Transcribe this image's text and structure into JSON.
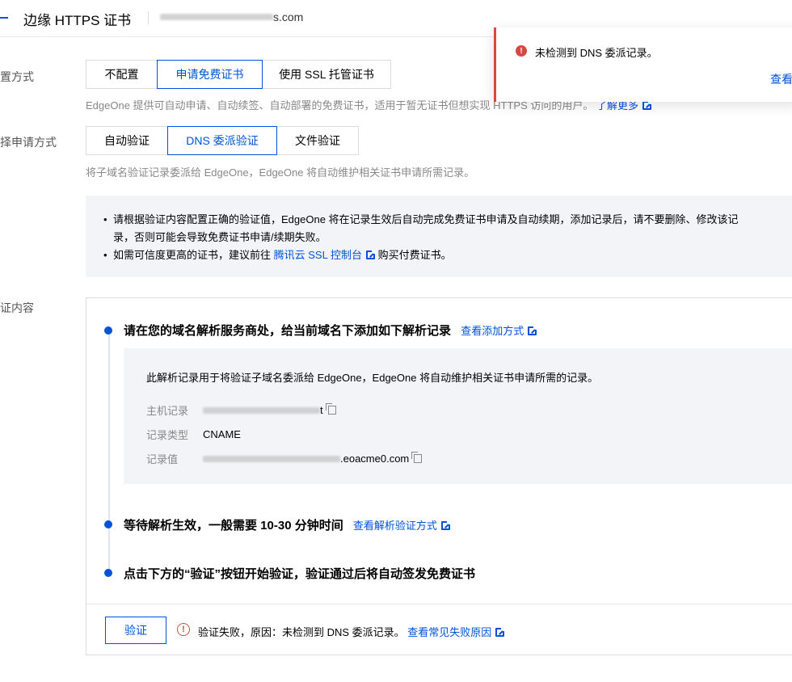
{
  "header": {
    "title": "边缘 HTTPS 证书",
    "domain_suffix": "s.com"
  },
  "config_method": {
    "label": "置方式",
    "options": [
      "不配置",
      "申请免费证书",
      "使用 SSL 托管证书"
    ],
    "selected": "申请免费证书",
    "hint": "EdgeOne 提供可自动申请、自动续签、自动部署的免费证书，适用于暂无证书但想实现 HTTPS 访问的用户。",
    "hint_link": "了解更多"
  },
  "apply_method": {
    "label": "择申请方式",
    "options": [
      "自动验证",
      "DNS 委派验证",
      "文件验证"
    ],
    "selected": "DNS 委派验证",
    "hint": "将子域名验证记录委派给 EdgeOne，EdgeOne 将自动维护相关证书申请所需记录。"
  },
  "notice": {
    "item1": "请根据验证内容配置正确的验证值，EdgeOne 将在记录生效后自动完成免费证书申请及自动续期，添加记录后，请不要删除、修改该记",
    "item1_cont": "录，否则可能会导致免费证书申请/续期失败。",
    "item2_pre": "如需可信度更高的证书，建议前往",
    "item2_link": "腾讯云 SSL 控制台",
    "item2_post": "购买付费证书。"
  },
  "verify_content": {
    "label": "证内容",
    "step1_title": "请在您的域名解析服务商处，给当前域名下添加如下解析记录",
    "step1_link": "查看添加方式",
    "record_desc": "此解析记录用于将验证子域名委派给 EdgeOne，EdgeOne 将自动维护相关证书申请所需的记录。",
    "host_label": "主机记录",
    "host_suffix": "t",
    "type_label": "记录类型",
    "type_value": "CNAME",
    "value_label": "记录值",
    "value_suffix": ".eoacme0.com",
    "step2_title": "等待解析生效，一般需要 10-30 分钟时间",
    "step2_link": "查看解析验证方式",
    "step3_title": "点击下方的“验证”按钮开始验证，验证通过后将自动签发免费证书",
    "verify_button": "验证",
    "fail_text": "验证失败，原因：未检测到 DNS 委派记录。",
    "fail_link": "查看常见失败原因"
  },
  "toast": {
    "message": "未检测到 DNS 委派记录。",
    "link": "查看"
  },
  "colors": {
    "brand": "#0052d9",
    "error": "#d54941",
    "panel_bg": "#f3f4f7"
  }
}
